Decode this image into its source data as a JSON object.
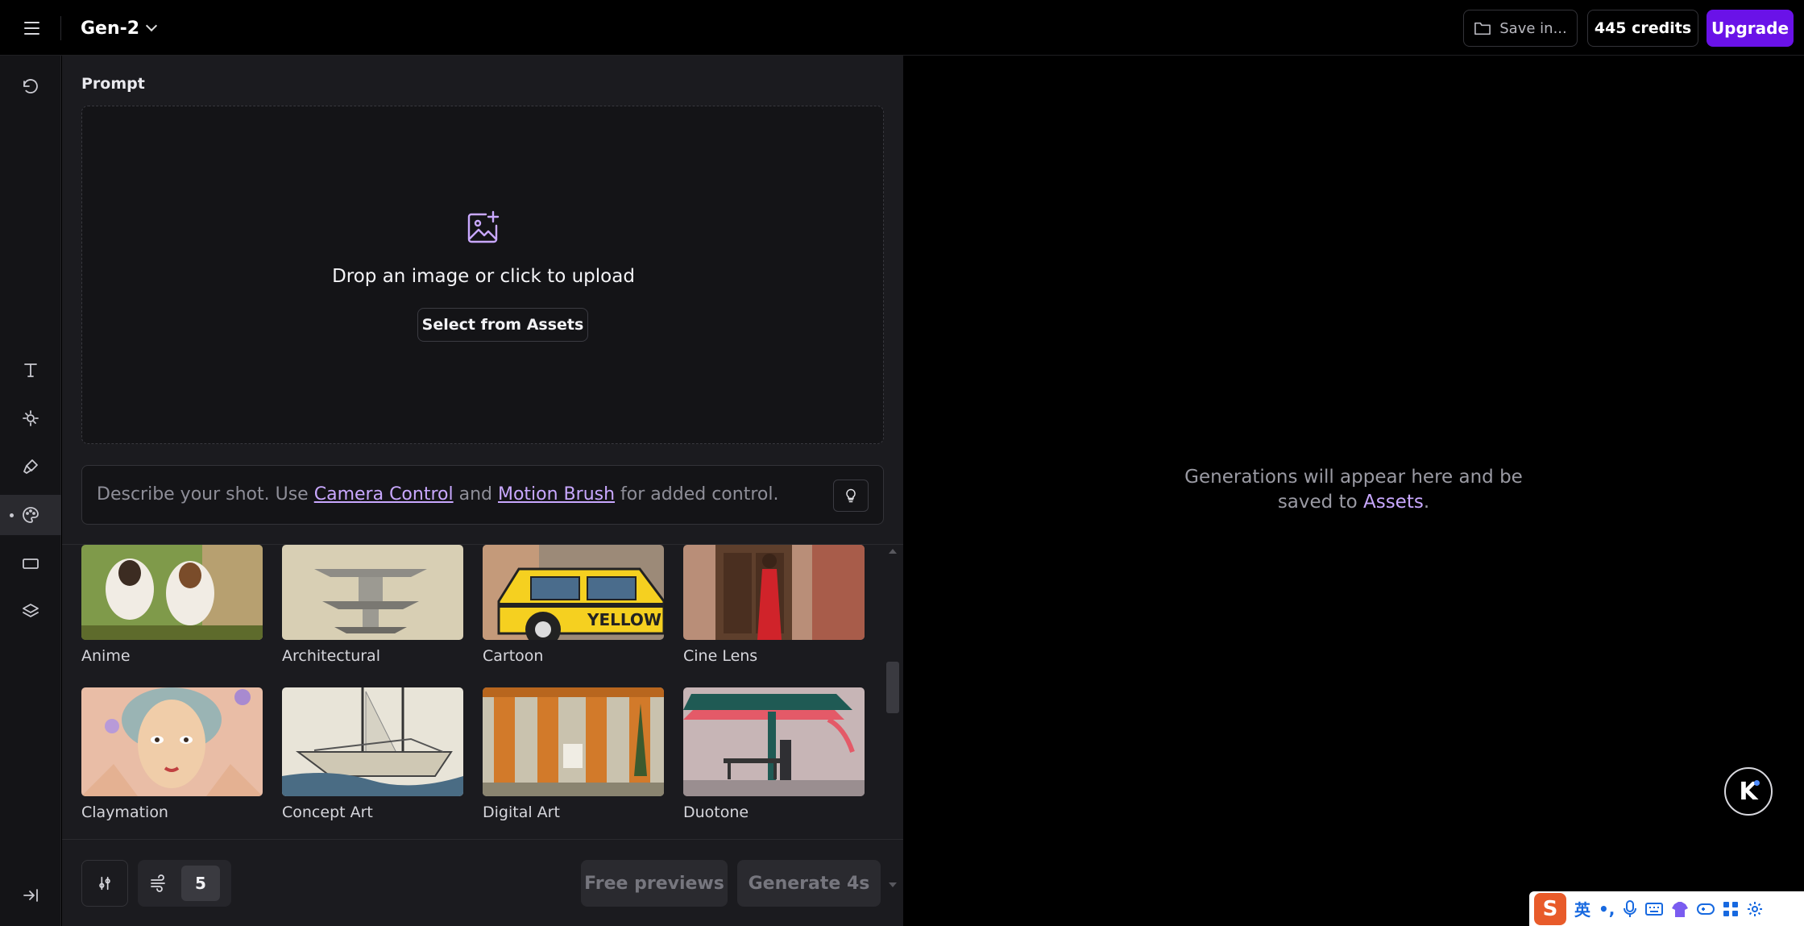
{
  "topbar": {
    "app_title": "Gen-2",
    "save_label": "Save in...",
    "credits_label": "445 credits",
    "upgrade_label": "Upgrade"
  },
  "rail": {
    "items": [
      "undo-icon",
      "text-icon",
      "camera-control-icon",
      "motion-brush-icon",
      "palette-icon",
      "aspect-ratio-icon",
      "layers-icon",
      "collapse-icon"
    ]
  },
  "prompt": {
    "label": "Prompt",
    "drop_text": "Drop an image or click to upload",
    "select_assets_label": "Select from Assets",
    "placeholder_prefix": "Describe your shot. Use",
    "camera_control_link": "Camera Control",
    "and_text": "and",
    "motion_brush_link": "Motion Brush",
    "placeholder_suffix": "for added control."
  },
  "styles": [
    {
      "label": "Anime"
    },
    {
      "label": "Architectural"
    },
    {
      "label": "Cartoon"
    },
    {
      "label": "Cine Lens"
    },
    {
      "label": "Claymation"
    },
    {
      "label": "Concept Art"
    },
    {
      "label": "Digital Art"
    },
    {
      "label": "Duotone"
    }
  ],
  "cartoon_sign_text": "YELLOW TAXI",
  "footer": {
    "motion_value": "5",
    "free_previews_label": "Free previews",
    "generate_label": "Generate 4s"
  },
  "output": {
    "message_line1": "Generations will appear here and be",
    "message_prefix": "saved to",
    "assets_link": "Assets",
    "message_suffix": "."
  },
  "assistant_button_label": "K",
  "ime": {
    "logo": "S",
    "lang": "英",
    "punct": "•,"
  },
  "colors": {
    "accent": "#6a12e8",
    "link": "#c9a8ff",
    "panel": "#1b1b1f"
  }
}
